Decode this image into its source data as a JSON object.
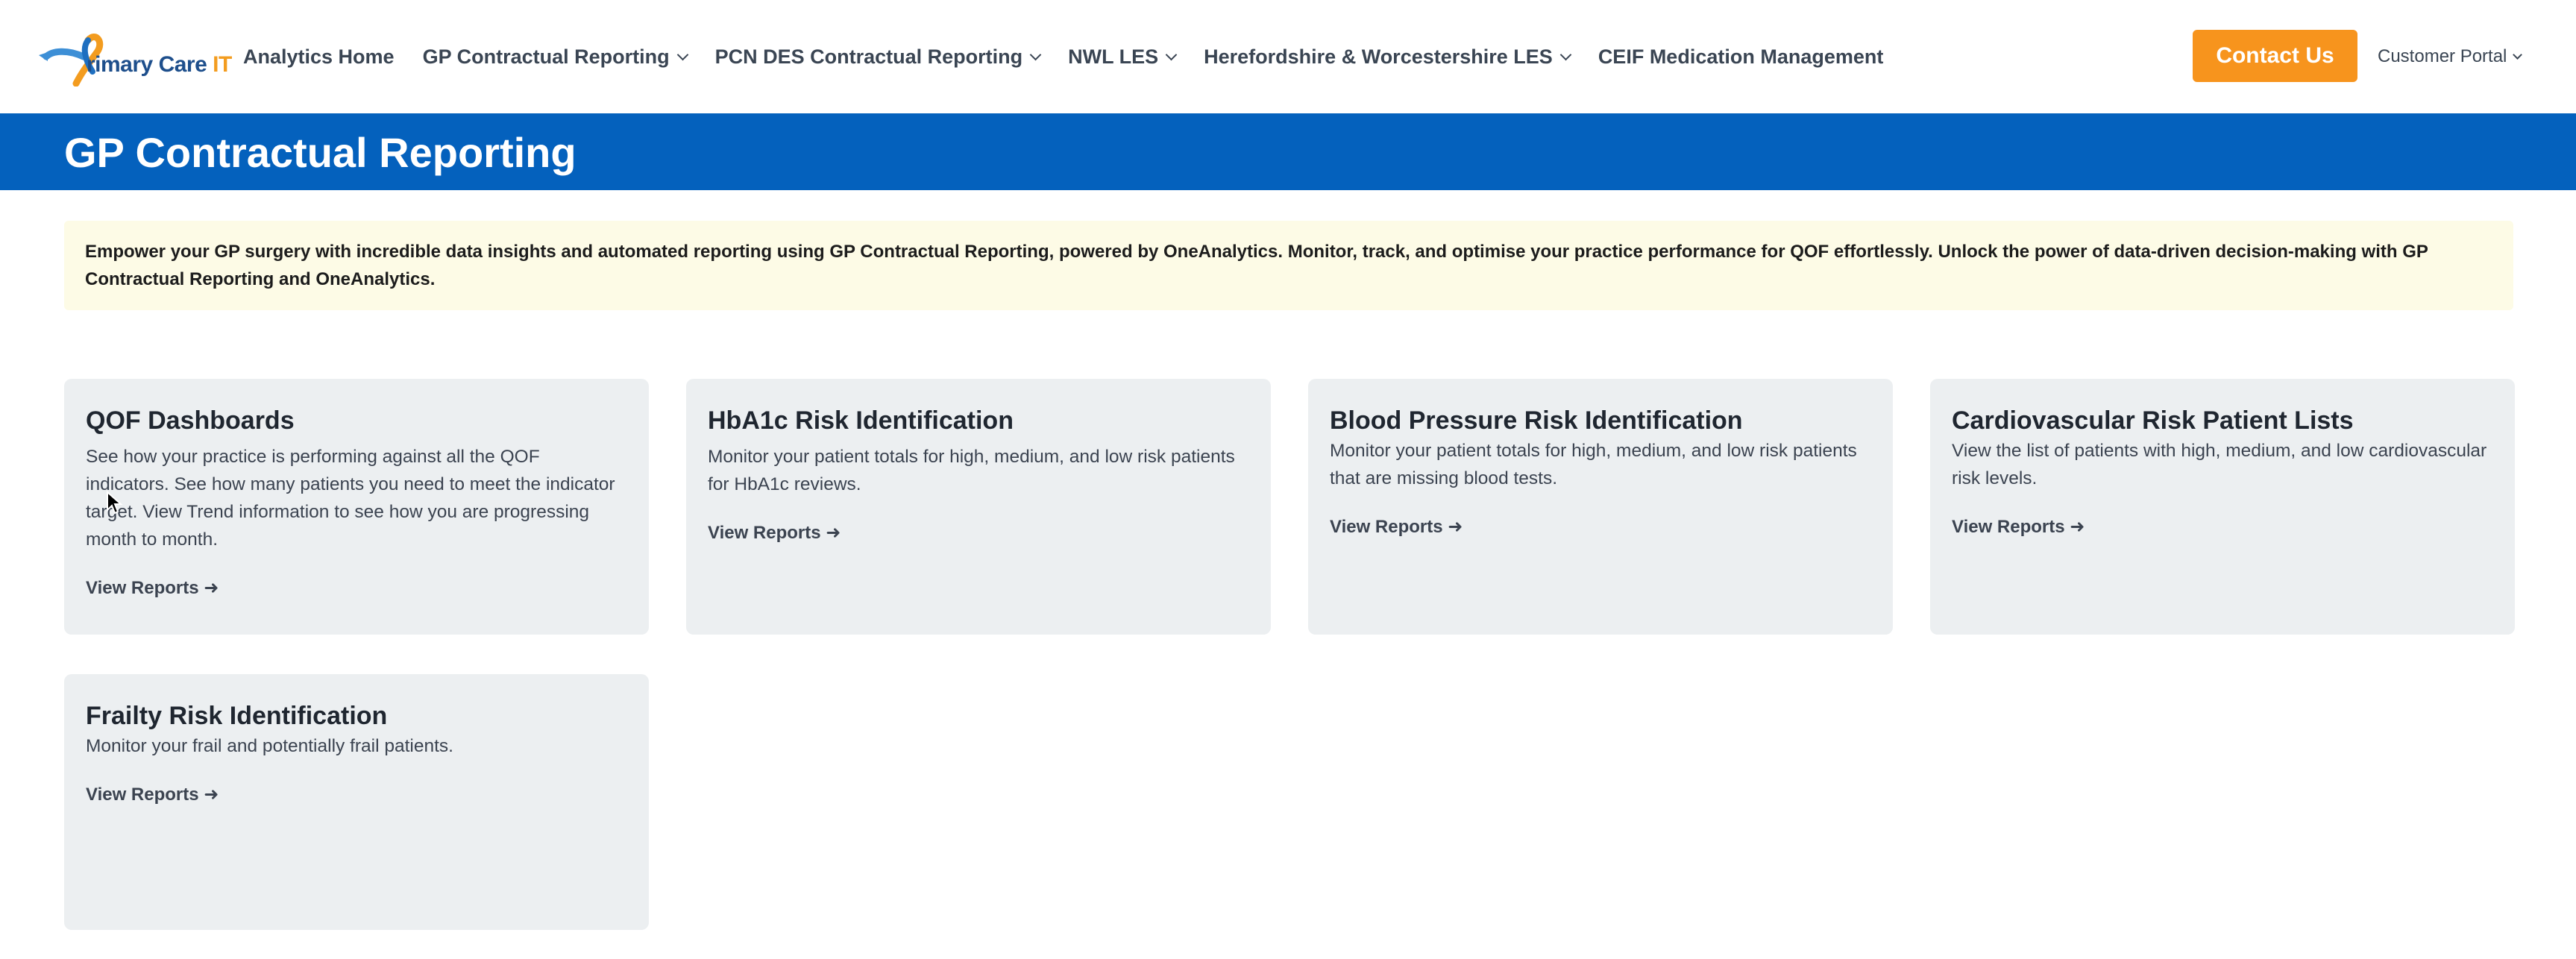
{
  "header": {
    "logo": {
      "text_primary": "rimary Care ",
      "text_accent": "IT"
    },
    "nav": [
      {
        "label": "Analytics Home",
        "dropdown": false
      },
      {
        "label": "GP Contractual Reporting",
        "dropdown": true
      },
      {
        "label": "PCN DES Contractual Reporting",
        "dropdown": true
      },
      {
        "label": "NWL LES",
        "dropdown": true
      },
      {
        "label": "Herefordshire & Worcestershire LES",
        "dropdown": true
      },
      {
        "label": "CEIF Medication Management",
        "dropdown": false
      }
    ],
    "contact_button": "Contact Us",
    "customer_portal": "Customer Portal"
  },
  "page": {
    "title": "GP Contractual Reporting",
    "intro": "Empower your GP surgery with incredible data insights and automated reporting using GP Contractual Reporting, powered by OneAnalytics. Monitor, track, and optimise your practice performance for QOF effortlessly. Unlock the power of data-driven decision-making with GP Contractual Reporting and OneAnalytics."
  },
  "cards": [
    {
      "title": "QOF Dashboards",
      "description": "See how your practice is performing against all the QOF indicators. See how many patients you need to meet the indicator target. View Trend information to see how you are progressing month to month.",
      "link": "View Reports ➜"
    },
    {
      "title": "HbA1c Risk Identification",
      "description": "Monitor your patient totals for high, medium, and low risk patients for HbA1c reviews.",
      "link": "View Reports ➜"
    },
    {
      "title": "Blood Pressure Risk Identification",
      "description": "Monitor your patient totals for high, medium, and low risk patients that are missing blood tests.",
      "link": "View Reports ➜"
    },
    {
      "title": "Cardiovascular Risk Patient Lists",
      "description": "View the list of patients with high, medium, and low cardiovascular risk levels.",
      "link": "View Reports ➜"
    },
    {
      "title": "Frailty Risk Identification",
      "description": "Monitor your frail and potentially frail patients.",
      "link": "View Reports ➜"
    }
  ],
  "colors": {
    "brand_blue": "#0461bd",
    "accent_orange": "#f7941d",
    "card_bg": "#eceff1",
    "notice_bg": "#fdfbe6"
  }
}
